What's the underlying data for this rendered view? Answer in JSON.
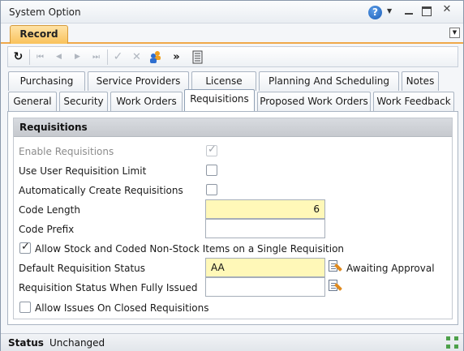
{
  "window": {
    "title": "System Option",
    "help_glyph": "?",
    "help_dropdown_glyph": "▼",
    "close_glyph": "✕"
  },
  "record_bar": {
    "tab_label": "Record",
    "menu_glyph": "▼"
  },
  "toolbar": {
    "refresh_glyph": "↻",
    "first_glyph": "⏮",
    "prev_glyph": "◀",
    "next_glyph": "▶",
    "last_glyph": "⏭",
    "save_glyph": "✓",
    "cancel_glyph": "✕",
    "more_glyph": "»"
  },
  "tabs": {
    "row_top": [
      "Purchasing",
      "Service Providers",
      "License",
      "Planning And Scheduling",
      "Notes"
    ],
    "row_bottom": [
      "General",
      "Security",
      "Work Orders",
      "Requisitions",
      "Proposed Work Orders",
      "Work Feedback"
    ],
    "active": "Requisitions"
  },
  "section": {
    "title": "Requisitions",
    "enable_requisitions": {
      "label": "Enable Requisitions",
      "checked": true,
      "disabled": true
    },
    "use_user_requisition_limit": {
      "label": "Use User Requisition Limit",
      "checked": false
    },
    "automatically_create_requisitions": {
      "label": "Automatically Create Requisitions",
      "checked": false
    },
    "code_length": {
      "label": "Code Length",
      "value": "6"
    },
    "code_prefix": {
      "label": "Code Prefix",
      "value": ""
    },
    "allow_stock_and_coded": {
      "label": "Allow Stock and Coded Non-Stock Items on a Single Requisition",
      "checked": true
    },
    "default_requisition_status": {
      "label": "Default Requisition Status",
      "value": "AA",
      "description": "Awaiting Approval"
    },
    "requisition_status_fully_issued": {
      "label": "Requisition Status When Fully Issued",
      "value": ""
    },
    "allow_issues_on_closed": {
      "label": "Allow Issues On Closed Requisitions",
      "checked": false
    }
  },
  "status_bar": {
    "label": "Status",
    "value": "Unchanged"
  },
  "colors": {
    "record_tab": "#f9c25c",
    "required_field": "#fff8b8",
    "section_header": "#c6c9ce",
    "help_icon": "#1c5fb8"
  }
}
